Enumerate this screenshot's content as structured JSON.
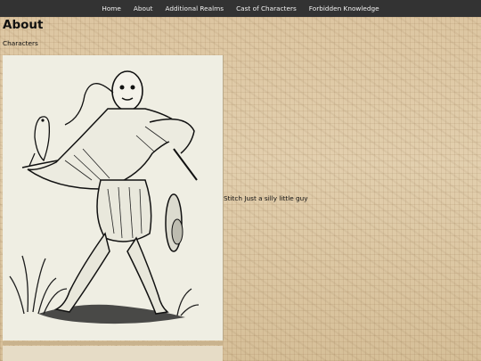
{
  "nav": {
    "items": [
      {
        "label": "Home"
      },
      {
        "label": "About"
      },
      {
        "label": "Additional Realms"
      },
      {
        "label": "Cast of Characters"
      },
      {
        "label": "Forbidden Knowledge"
      }
    ]
  },
  "page": {
    "title": "About",
    "section_label": "Characters"
  },
  "character": {
    "name": "Stitch",
    "description": "Just a silly little guy",
    "image_alt": "Woodcut figure with parrot"
  },
  "colors": {
    "nav_background": "#333333",
    "nav_text": "#f2f2f2",
    "page_background": "#d9c39f"
  }
}
